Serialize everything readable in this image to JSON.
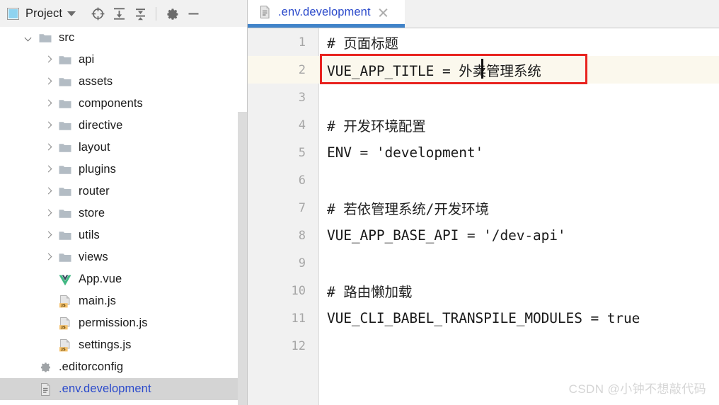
{
  "colors": {
    "accent_blue": "#2b4acb",
    "tab_underline": "#4083c9",
    "annotation_red": "#e8231f",
    "selected_row": "#d4d4d4",
    "caret_line": "#fbf8ed",
    "toolbar_bg": "#f1f1f1",
    "folder_icon": "#b3bcc4",
    "js_badge": "#f5c069",
    "vue_green": "#41b883",
    "vue_dark": "#35495e",
    "watermark": "#d5d5d5"
  },
  "sidebar": {
    "toolbar": {
      "project_label": "Project",
      "dropdown_icon": "chevron-down-icon",
      "swatch_icon": "project-view-icon",
      "buttons": [
        {
          "name": "locate-icon",
          "tooltip": "Select Opened File"
        },
        {
          "name": "expand-all-icon",
          "tooltip": "Expand All"
        },
        {
          "name": "collapse-all-icon",
          "tooltip": "Collapse All"
        },
        {
          "name": "gear-icon",
          "tooltip": "Settings"
        },
        {
          "name": "minimize-icon",
          "tooltip": "Hide"
        }
      ]
    },
    "tree": [
      {
        "label": "src",
        "icon": "folder-icon",
        "arrow": "down",
        "indent": 0,
        "selected": false,
        "blue": false
      },
      {
        "label": "api",
        "icon": "folder-icon",
        "arrow": "right",
        "indent": 1,
        "selected": false,
        "blue": false
      },
      {
        "label": "assets",
        "icon": "folder-icon",
        "arrow": "right",
        "indent": 1,
        "selected": false,
        "blue": false
      },
      {
        "label": "components",
        "icon": "folder-icon",
        "arrow": "right",
        "indent": 1,
        "selected": false,
        "blue": false
      },
      {
        "label": "directive",
        "icon": "folder-icon",
        "arrow": "right",
        "indent": 1,
        "selected": false,
        "blue": false
      },
      {
        "label": "layout",
        "icon": "folder-icon",
        "arrow": "right",
        "indent": 1,
        "selected": false,
        "blue": false
      },
      {
        "label": "plugins",
        "icon": "folder-icon",
        "arrow": "right",
        "indent": 1,
        "selected": false,
        "blue": false
      },
      {
        "label": "router",
        "icon": "folder-icon",
        "arrow": "right",
        "indent": 1,
        "selected": false,
        "blue": false
      },
      {
        "label": "store",
        "icon": "folder-icon",
        "arrow": "right",
        "indent": 1,
        "selected": false,
        "blue": false
      },
      {
        "label": "utils",
        "icon": "folder-icon",
        "arrow": "right",
        "indent": 1,
        "selected": false,
        "blue": false
      },
      {
        "label": "views",
        "icon": "folder-icon",
        "arrow": "right",
        "indent": 1,
        "selected": false,
        "blue": false
      },
      {
        "label": "App.vue",
        "icon": "vue-file-icon",
        "arrow": "none",
        "indent": 1,
        "selected": false,
        "blue": false
      },
      {
        "label": "main.js",
        "icon": "js-file-icon",
        "arrow": "none",
        "indent": 1,
        "selected": false,
        "blue": false
      },
      {
        "label": "permission.js",
        "icon": "js-file-icon",
        "arrow": "none",
        "indent": 1,
        "selected": false,
        "blue": false
      },
      {
        "label": "settings.js",
        "icon": "js-file-icon",
        "arrow": "none",
        "indent": 1,
        "selected": false,
        "blue": false
      },
      {
        "label": ".editorconfig",
        "icon": "gear-file-icon",
        "arrow": "none",
        "indent": 0,
        "selected": false,
        "blue": false
      },
      {
        "label": ".env.development",
        "icon": "text-file-icon",
        "arrow": "none",
        "indent": 0,
        "selected": true,
        "blue": true
      }
    ],
    "scrollbar": {
      "name": "sidebar-scrollbar"
    }
  },
  "editor": {
    "tab": {
      "label": ".env.development",
      "icon": "text-file-icon",
      "close_icon": "close-icon",
      "active": true
    },
    "lines": [
      {
        "num": "1",
        "text": "# 页面标题",
        "comment": true,
        "highlight": false
      },
      {
        "num": "2",
        "text": "VUE_APP_TITLE = 外卖管理系统",
        "comment": false,
        "highlight": true
      },
      {
        "num": "3",
        "text": "",
        "comment": false,
        "highlight": false
      },
      {
        "num": "4",
        "text": "# 开发环境配置",
        "comment": true,
        "highlight": false
      },
      {
        "num": "5",
        "text": "ENV = 'development'",
        "comment": false,
        "highlight": false
      },
      {
        "num": "6",
        "text": "",
        "comment": false,
        "highlight": false
      },
      {
        "num": "7",
        "text": "# 若依管理系统/开发环境",
        "comment": true,
        "highlight": false
      },
      {
        "num": "8",
        "text": "VUE_APP_BASE_API = '/dev-api'",
        "comment": false,
        "highlight": false
      },
      {
        "num": "9",
        "text": "",
        "comment": false,
        "highlight": false
      },
      {
        "num": "10",
        "text": "# 路由懒加载",
        "comment": true,
        "highlight": false
      },
      {
        "num": "11",
        "text": "VUE_CLI_BABEL_TRANSPILE_MODULES = true",
        "comment": false,
        "highlight": false
      },
      {
        "num": "12",
        "text": "",
        "comment": false,
        "highlight": false
      }
    ],
    "annotation": {
      "name": "red-highlight-box",
      "target_line": "2"
    },
    "caret": {
      "line": "2",
      "before_text": "外卖管理系统"
    }
  },
  "watermark": {
    "text": "CSDN @小钟不想敲代码"
  }
}
